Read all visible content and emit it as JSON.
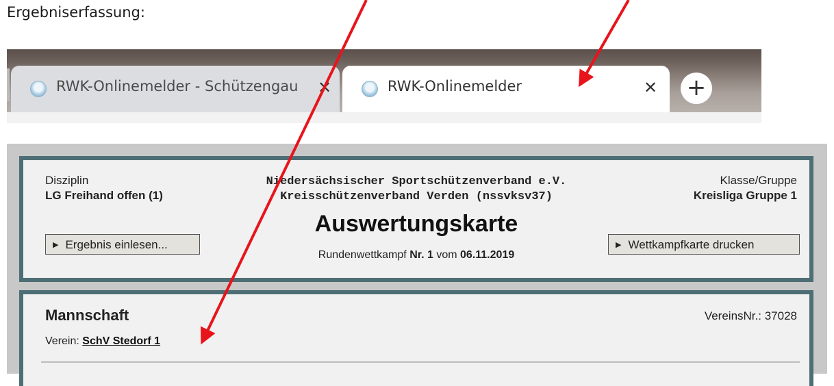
{
  "intro_text": "Ergebniserfassung:",
  "browser": {
    "tabs": [
      {
        "title": "RWK-Onlinemelder - Schützengau",
        "active": false
      },
      {
        "title": "RWK-Onlinemelder",
        "active": true
      }
    ],
    "new_tab_label": "+",
    "close_glyph": "✕"
  },
  "header": {
    "disziplin_label": "Disziplin",
    "disziplin_value": "LG Freihand offen (1)",
    "org_line1": "Niedersächsischer Sportschützenverband e.V.",
    "org_line2": "Kreisschützenverband Verden (nssvksv37)",
    "title": "Auswertungskarte",
    "round_prefix": "Rundenwettkampf",
    "round_nr": "Nr. 1",
    "round_mid": "vom",
    "round_date": "06.11.2019",
    "klasse_label": "Klasse/Gruppe",
    "klasse_value": "Kreisliga Gruppe 1",
    "btn_einlesen": "Ergebnis einlesen...",
    "btn_drucken": "Wettkampfkarte drucken"
  },
  "team": {
    "heading": "Mannschaft",
    "verein_label": "Verein:",
    "verein_name": "SchV Stedorf 1",
    "vnr_label": "VereinsNr.:",
    "vnr_value": "37028"
  },
  "colors": {
    "annotation_arrow": "#e8141b",
    "panel_border": "#4e6e76"
  }
}
